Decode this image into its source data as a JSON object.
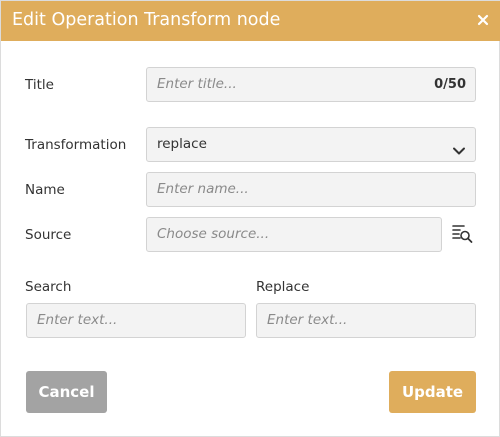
{
  "dialog": {
    "title": "Edit Operation Transform node",
    "close_icon": "close-icon"
  },
  "form": {
    "title_label": "Title",
    "title_placeholder": "Enter title...",
    "title_counter": "0/50",
    "transformation_label": "Transformation",
    "transformation_value": "replace",
    "name_label": "Name",
    "name_placeholder": "Enter name...",
    "source_label": "Source",
    "source_placeholder": "Choose source...",
    "source_icon": "search-list-icon",
    "search_label": "Search",
    "search_placeholder": "Enter text...",
    "replace_label": "Replace",
    "replace_placeholder": "Enter text..."
  },
  "buttons": {
    "cancel": "Cancel",
    "update": "Update"
  },
  "colors": {
    "accent": "#dfad5c",
    "cancel": "#a3a3a3"
  }
}
